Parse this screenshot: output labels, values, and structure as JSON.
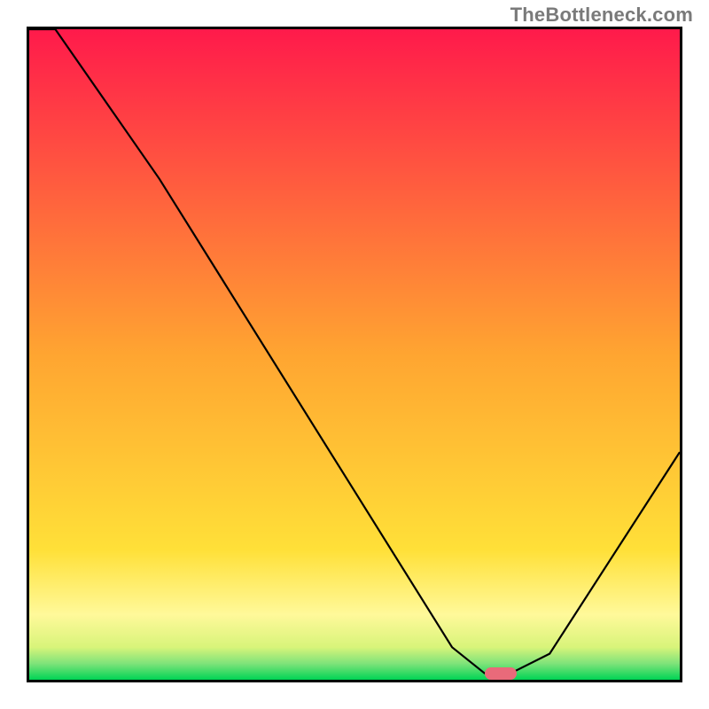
{
  "watermark": "TheBottleneck.com",
  "chart_data": {
    "type": "line",
    "title": "",
    "xlabel": "",
    "ylabel": "",
    "xlim": [
      0,
      100
    ],
    "ylim": [
      0,
      100
    ],
    "x": [
      0,
      4,
      20,
      65,
      70,
      74,
      80,
      100
    ],
    "values": [
      100,
      100,
      77,
      5,
      1,
      1,
      4,
      35
    ],
    "marker": {
      "x_start": 70,
      "x_end": 75,
      "y": 1
    },
    "background_gradient_stops": [
      {
        "pos": 0.0,
        "color": "#ff1a4b"
      },
      {
        "pos": 0.5,
        "color": "#ffa531"
      },
      {
        "pos": 0.8,
        "color": "#ffe038"
      },
      {
        "pos": 0.9,
        "color": "#fff99a"
      },
      {
        "pos": 0.95,
        "color": "#d8f47a"
      },
      {
        "pos": 0.975,
        "color": "#7fe37a"
      },
      {
        "pos": 1.0,
        "color": "#00d455"
      }
    ]
  }
}
